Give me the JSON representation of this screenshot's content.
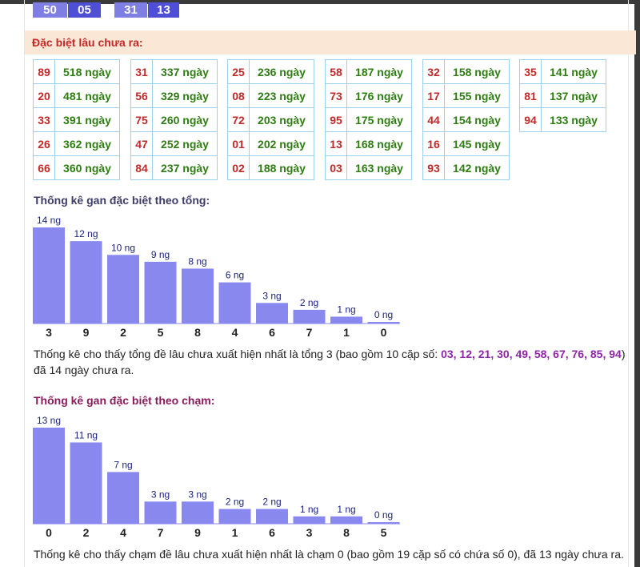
{
  "chips": [
    "50",
    "05",
    "31",
    "13"
  ],
  "section_title": "Đặc biệt lâu chưa ra:",
  "columns": [
    [
      [
        "89",
        "518 ngày"
      ],
      [
        "20",
        "481 ngày"
      ],
      [
        "33",
        "391 ngày"
      ],
      [
        "26",
        "362 ngày"
      ],
      [
        "66",
        "360 ngày"
      ]
    ],
    [
      [
        "31",
        "337 ngày"
      ],
      [
        "56",
        "329 ngày"
      ],
      [
        "75",
        "260 ngày"
      ],
      [
        "47",
        "252 ngày"
      ],
      [
        "84",
        "237 ngày"
      ]
    ],
    [
      [
        "25",
        "236 ngày"
      ],
      [
        "08",
        "223 ngày"
      ],
      [
        "72",
        "203 ngày"
      ],
      [
        "01",
        "202 ngày"
      ],
      [
        "02",
        "188 ngày"
      ]
    ],
    [
      [
        "58",
        "187 ngày"
      ],
      [
        "73",
        "176 ngày"
      ],
      [
        "95",
        "175 ngày"
      ],
      [
        "13",
        "168 ngày"
      ],
      [
        "03",
        "163 ngày"
      ]
    ],
    [
      [
        "32",
        "158 ngày"
      ],
      [
        "17",
        "155 ngày"
      ],
      [
        "44",
        "154 ngày"
      ],
      [
        "16",
        "145 ngày"
      ],
      [
        "93",
        "142 ngày"
      ]
    ],
    [
      [
        "35",
        "141 ngày"
      ],
      [
        "81",
        "137 ngày"
      ],
      [
        "94",
        "133 ngày"
      ]
    ]
  ],
  "stat_tong": {
    "title": "Thống kê gan đặc biệt theo tổng:",
    "desc_prefix": "Thống kê cho thấy tổng đề lâu chưa xuất hiện nhất là tổng 3 (bao gồm 10 cặp số: ",
    "desc_highlight": "03, 12, 21, 30, 49, 58, 67, 76, 85, 94",
    "desc_suffix": ") đã 14 ngày chưa ra."
  },
  "stat_cham": {
    "title": "Thống kê gan đặc biệt theo chạm:",
    "desc": "Thống kê cho thấy chạm đề lâu chưa xuất hiện nhất là chạm 0 (bao gồm 19 cặp số có chứa số 0), đã 13 ngày chưa ra."
  },
  "chart_data": [
    {
      "type": "bar",
      "categories": [
        "3",
        "9",
        "2",
        "5",
        "8",
        "4",
        "6",
        "7",
        "1",
        "0"
      ],
      "values": [
        14,
        12,
        10,
        9,
        8,
        6,
        3,
        2,
        1,
        0
      ],
      "value_labels": [
        "14 ng",
        "12 ng",
        "10 ng",
        "9 ng",
        "8 ng",
        "6 ng",
        "3 ng",
        "2 ng",
        "1 ng",
        "0 ng"
      ],
      "ylim": [
        0,
        14
      ],
      "color": "#8888ee"
    },
    {
      "type": "bar",
      "categories": [
        "0",
        "2",
        "4",
        "7",
        "9",
        "1",
        "6",
        "3",
        "8",
        "5"
      ],
      "values": [
        13,
        11,
        7,
        3,
        3,
        2,
        2,
        1,
        1,
        0
      ],
      "value_labels": [
        "13 ng",
        "11 ng",
        "7 ng",
        "3 ng",
        "3 ng",
        "2 ng",
        "2 ng",
        "1 ng",
        "1 ng",
        "0 ng"
      ],
      "ylim": [
        0,
        13
      ],
      "color": "#8888ee"
    }
  ]
}
